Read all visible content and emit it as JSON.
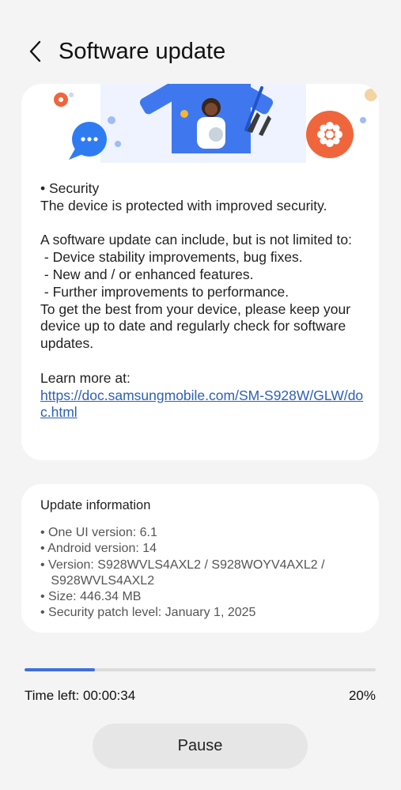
{
  "header": {
    "back_icon": "chevron-left-icon",
    "title": "Software update"
  },
  "release_notes": {
    "lines": [
      "• Security",
      "The device is protected with improved security.",
      "",
      "A software update can include, but is not limited to:",
      " - Device stability improvements, bug fixes.",
      " - New and / or enhanced features.",
      " - Further improvements to performance.",
      "To get the best from your device, please keep your device up to date and regularly check for software updates.",
      "",
      "Learn more at:"
    ],
    "link": "https://doc.samsungmobile.com/SM-S928W/GLW/doc.html"
  },
  "update_info": {
    "title": "Update information",
    "items": [
      "• One UI version: 6.1",
      "• Android version: 14",
      "• Version: S928WVLS4AXL2 / S928WOYV4AXL2 /\n   S928WVLS4AXL2",
      "• Size: 446.34 MB",
      "• Security patch level: January 1, 2025"
    ]
  },
  "progress": {
    "fraction": 0.2,
    "time_left": "Time left: 00:00:34",
    "percent": "20%",
    "fill_color": "#3e6fdc"
  },
  "pause_button": {
    "label": "Pause"
  }
}
